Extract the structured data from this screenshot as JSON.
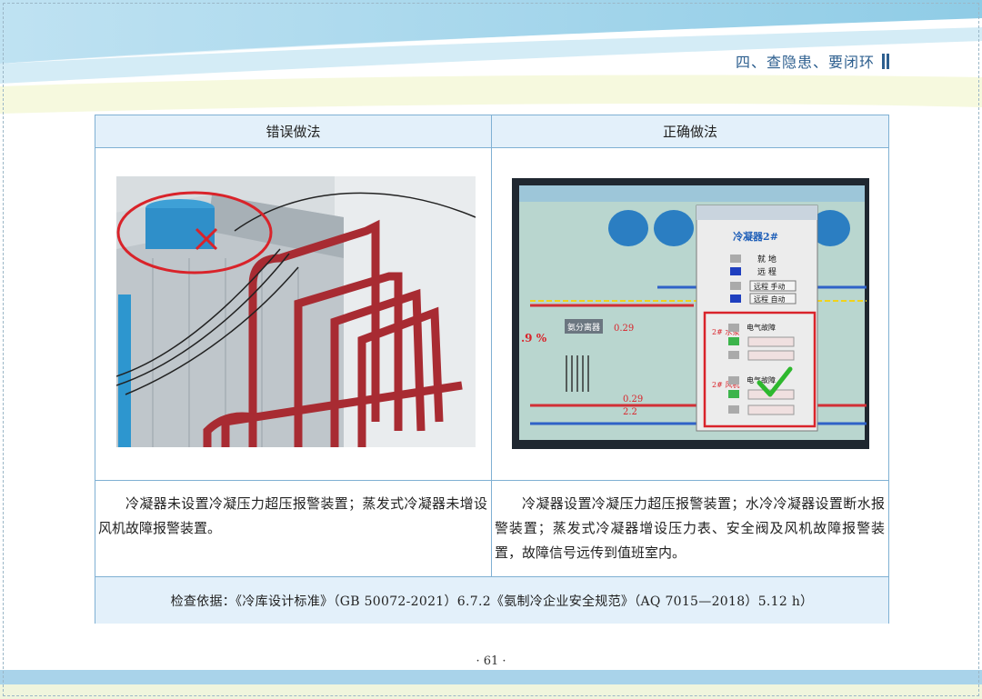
{
  "header": {
    "chapter_title": "四、查隐患、要闭环"
  },
  "table": {
    "left_header": "错误做法",
    "right_header": "正确做法",
    "left_description": "冷凝器未设置冷凝压力超压报警装置；蒸发式冷凝器未增设风机故障报警装置。",
    "right_description": "冷凝器设置冷凝压力超压报警装置；水冷冷凝器设置断水报警装置；蒸发式冷凝器增设压力表、安全阀及风机故障报警装置，故障信号远传到值班室内。",
    "basis": "检查依据：《冷库设计标准》（GB 50072-2021）6.7.2《氨制冷企业安全规范》（AQ 7015—2018）5.12 h）"
  },
  "screen_panel": {
    "title": "冷凝器2#",
    "labels": [
      "就 地",
      "远 程",
      "远程 手动",
      "远程 自动",
      "电气故障",
      "电气故障"
    ],
    "side_labels": [
      "2# 水泵",
      "2# 风机"
    ],
    "gauge_1": "0.29",
    "gauge_2": "0.29",
    "gauge_3": "2.2",
    "left_value": ".9 %",
    "tank_label": "氨分离器"
  },
  "footer": {
    "page_number": "· 61 ·"
  },
  "colors": {
    "accent": "#2d5f8f",
    "table_header_bg": "#e3f0fa",
    "table_border": "#7fb0d3",
    "mark_red": "#d9232a",
    "check_green": "#2eb82e"
  }
}
